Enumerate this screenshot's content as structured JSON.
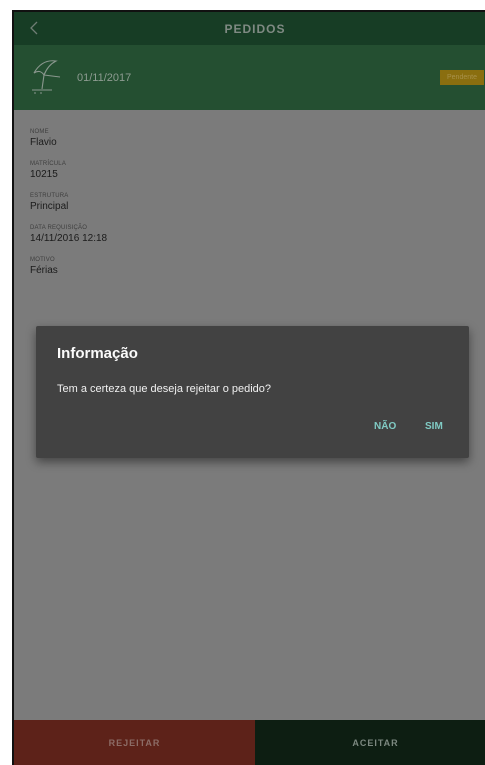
{
  "app": {
    "title": "PEDIDOS"
  },
  "request": {
    "date": "01/11/2017",
    "status": "Pendente"
  },
  "fields": [
    {
      "label": "NOME",
      "value": "Flavio"
    },
    {
      "label": "MATRÍCULA",
      "value": "10215"
    },
    {
      "label": "ESTRUTURA",
      "value": "Principal"
    },
    {
      "label": "DATA REQUISIÇÃO",
      "value": "14/11/2016 12:18"
    },
    {
      "label": "MOTIVO",
      "value": "Férias"
    }
  ],
  "actions": {
    "reject": "REJEITAR",
    "accept": "ACEITAR"
  },
  "dialog": {
    "title": "Informação",
    "message": "Tem a certeza que deseja rejeitar o pedido?",
    "no": "NÃO",
    "yes": "SIM"
  },
  "colors": {
    "appbar": "#173d25",
    "header": "#244f31",
    "overlay": "#7b7b7b",
    "dialog": "#424242",
    "dialog_button": "#80cbc4",
    "reject": "#5d2219",
    "accept": "#0d1e12",
    "badge": "#8a6e0f"
  },
  "icons": {
    "back": "chevron-left-icon",
    "category": "beach-umbrella-icon"
  }
}
